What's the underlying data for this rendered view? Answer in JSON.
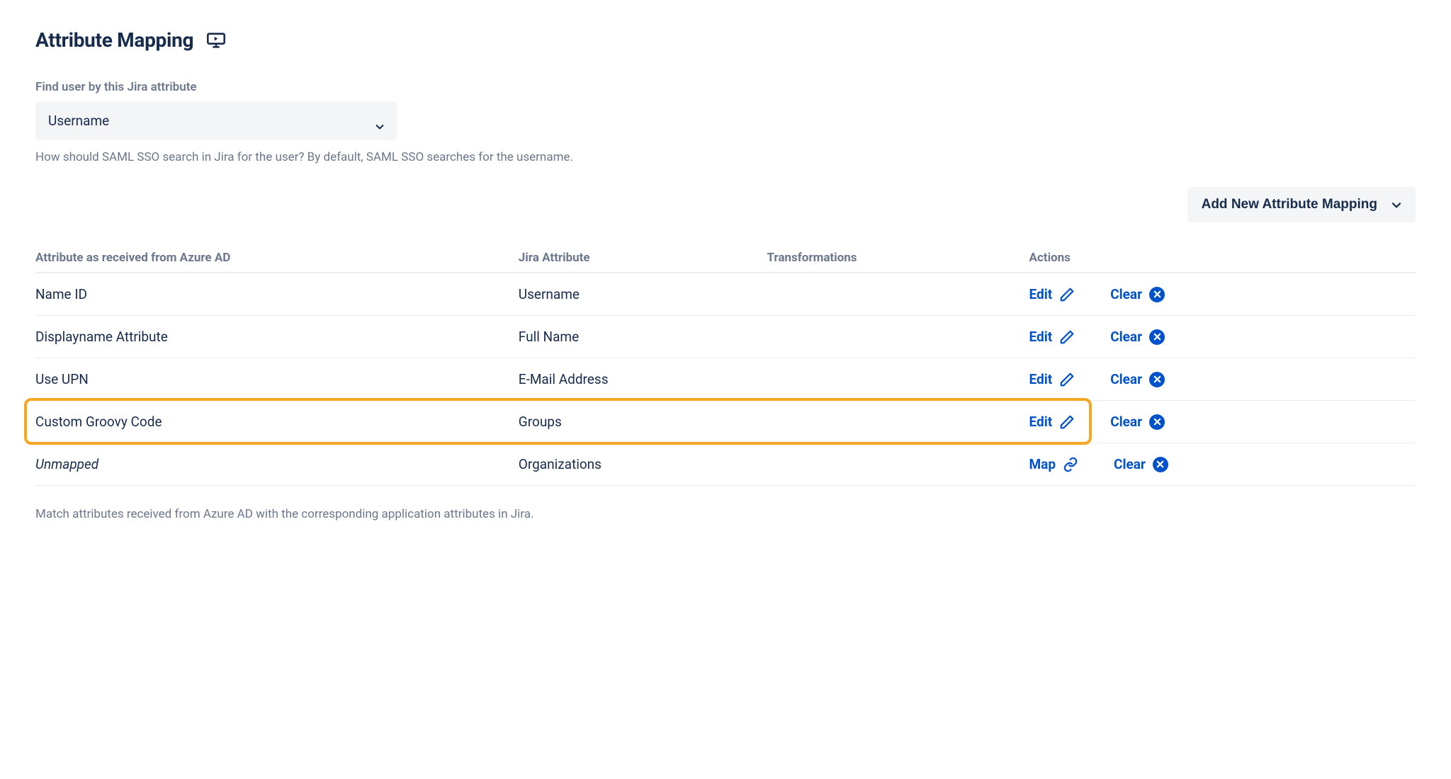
{
  "header": {
    "title": "Attribute Mapping"
  },
  "findUser": {
    "label": "Find user by this Jira attribute",
    "selected": "Username",
    "help": "How should SAML SSO search in Jira for the user? By default, SAML SSO searches for the username."
  },
  "addButton": {
    "label": "Add New Attribute Mapping"
  },
  "table": {
    "columns": {
      "source": "Attribute as received from Azure AD",
      "jira": "Jira Attribute",
      "transformations": "Transformations",
      "actions": "Actions"
    },
    "rows": [
      {
        "source": "Name ID",
        "jira": "Username",
        "transformations": "",
        "primaryAction": "Edit",
        "secondaryAction": "Clear",
        "italic": false,
        "highlighted": false,
        "primaryIcon": "pencil"
      },
      {
        "source": "Displayname Attribute",
        "jira": "Full Name",
        "transformations": "",
        "primaryAction": "Edit",
        "secondaryAction": "Clear",
        "italic": false,
        "highlighted": false,
        "primaryIcon": "pencil"
      },
      {
        "source": "Use UPN",
        "jira": "E-Mail Address",
        "transformations": "",
        "primaryAction": "Edit",
        "secondaryAction": "Clear",
        "italic": false,
        "highlighted": false,
        "primaryIcon": "pencil"
      },
      {
        "source": "Custom Groovy Code",
        "jira": "Groups",
        "transformations": "",
        "primaryAction": "Edit",
        "secondaryAction": "Clear",
        "italic": false,
        "highlighted": true,
        "primaryIcon": "pencil"
      },
      {
        "source": "Unmapped",
        "jira": "Organizations",
        "transformations": "",
        "primaryAction": "Map",
        "secondaryAction": "Clear",
        "italic": true,
        "highlighted": false,
        "primaryIcon": "link"
      }
    ]
  },
  "footer": {
    "text": "Match attributes received from Azure AD with the corresponding application attributes in Jira."
  },
  "colors": {
    "link": "#0052CC",
    "highlight": "#F5A623",
    "muted": "#6B778C",
    "text": "#172B4D"
  }
}
